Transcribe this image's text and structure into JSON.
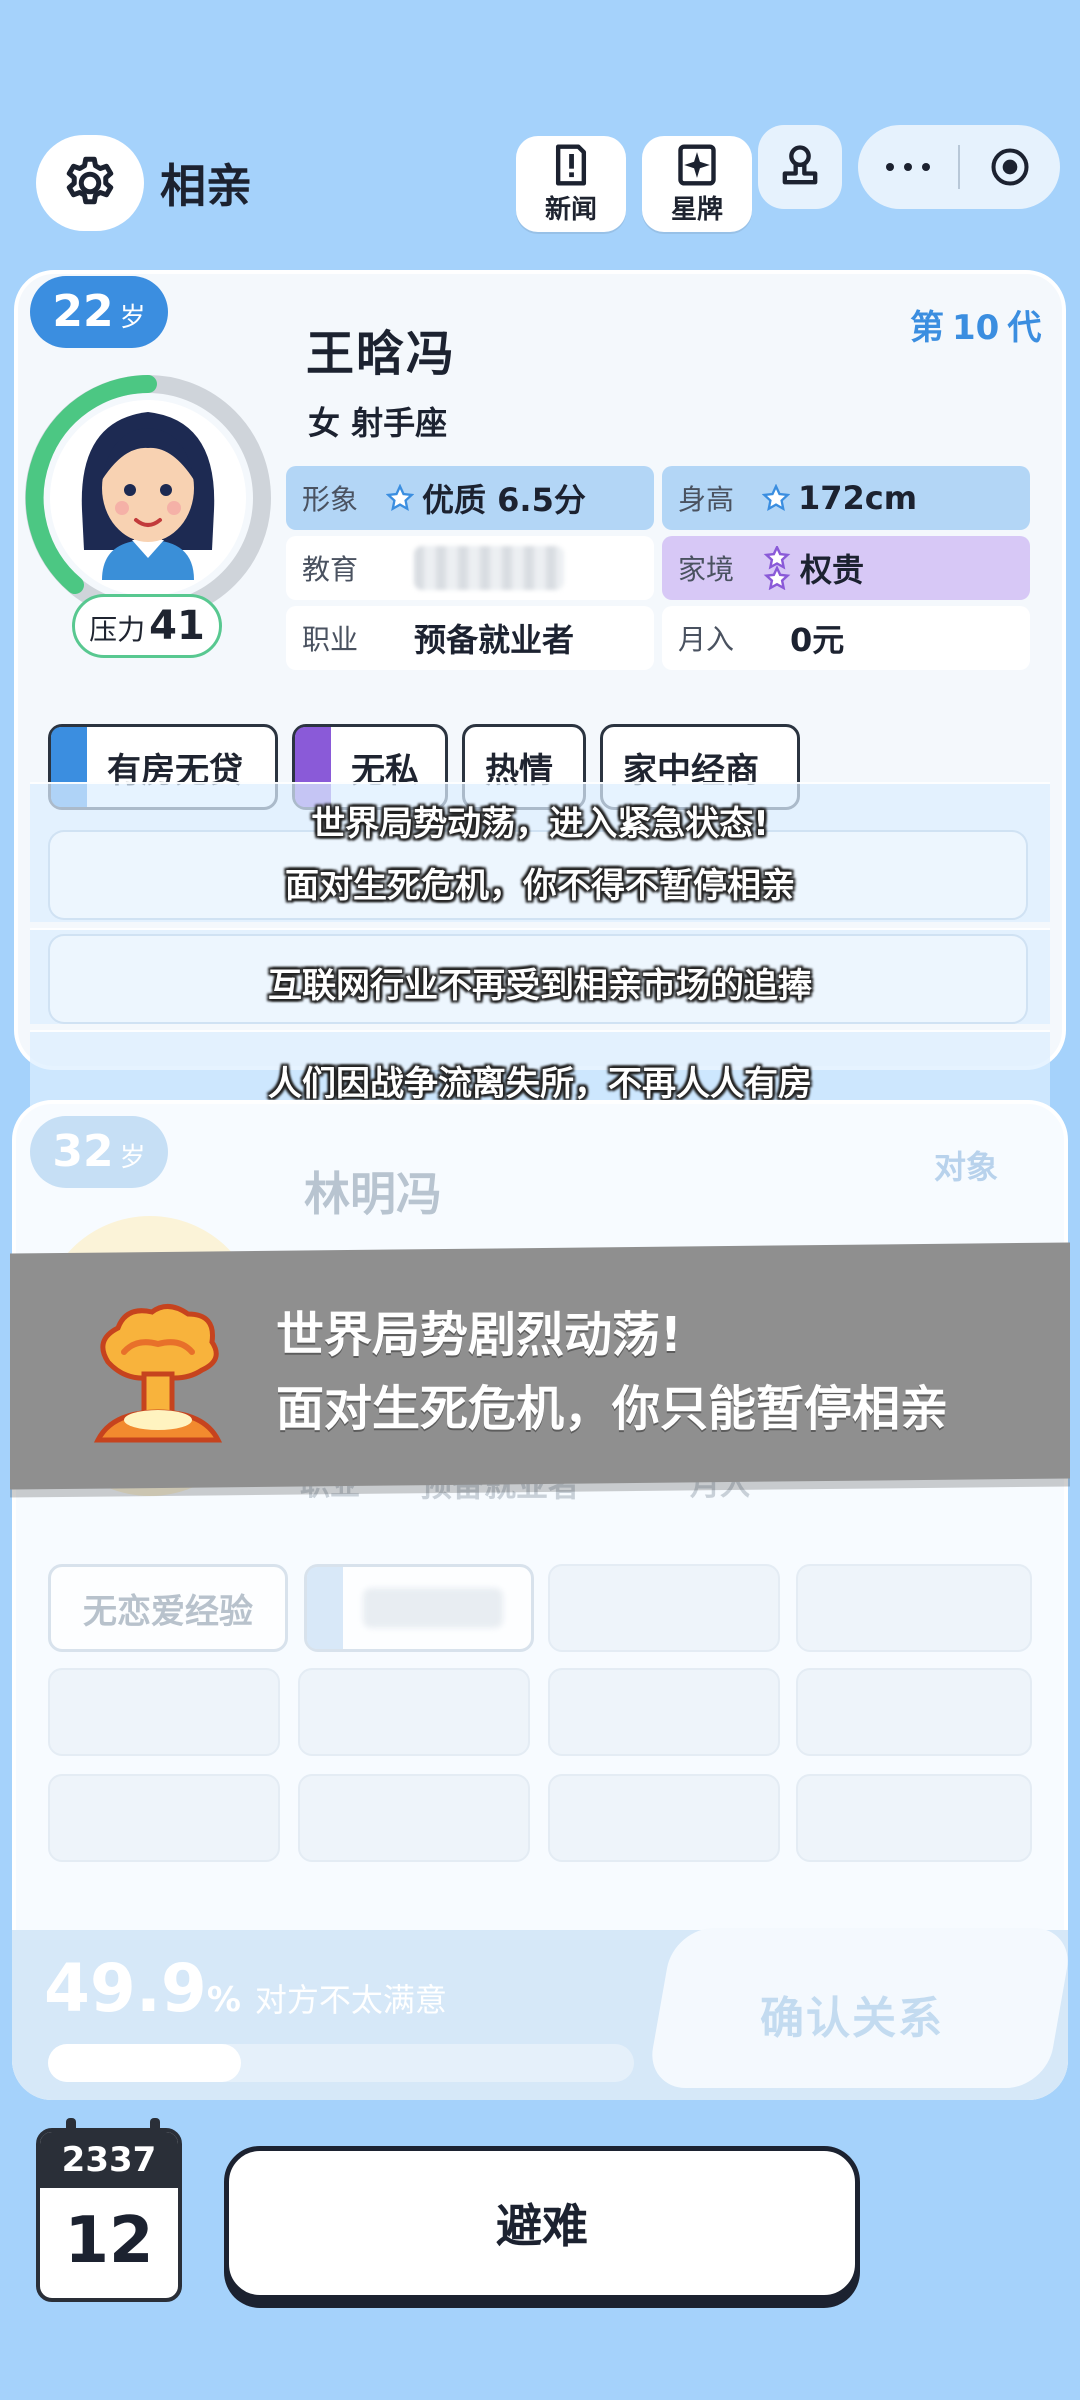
{
  "header": {
    "title": "相亲",
    "news_label": "新闻",
    "starcard_label": "星牌"
  },
  "profile": {
    "age": "22",
    "age_unit": "岁",
    "generation_prefix": "第",
    "generation": "10",
    "generation_suffix": "代",
    "name": "王晗冯",
    "gender_sign": "女 射手座",
    "stress_label": "压力",
    "stress_value": "41",
    "stats": {
      "appearance_label": "形象",
      "appearance_value": "优质 6.5分",
      "height_label": "身高",
      "height_value": "172cm",
      "education_label": "教育",
      "family_label": "家境",
      "family_value": "权贵",
      "job_label": "职业",
      "job_value": "预备就业者",
      "income_label": "月入",
      "income_value": "0元"
    },
    "tags": [
      "有房无贷",
      "无私",
      "热情",
      "家中经商"
    ]
  },
  "news": [
    "世界局势动荡，进入紧急状态!",
    "面对生死危机，你不得不暂停相亲",
    "互联网行业不再受到相亲市场的追捧",
    "人们因战争流离失所，不再人人有房"
  ],
  "partner": {
    "age": "32",
    "age_unit": "岁",
    "relation": "对象",
    "name": "林明冯",
    "job_value": "预备就业者",
    "income_label": "月入",
    "job_label": "职业",
    "tags": [
      "无恋爱经验"
    ]
  },
  "crisis": {
    "line1": "世界局势剧烈动荡!",
    "line2": "面对生死危机，你只能暂停相亲"
  },
  "match": {
    "percent": "49.9",
    "percent_sign": "%",
    "status": "对方不太满意",
    "progress": 0.329,
    "confirm_label": "确认关系"
  },
  "calendar": {
    "year": "2337",
    "day": "12"
  },
  "action": {
    "primary_label": "避难"
  }
}
